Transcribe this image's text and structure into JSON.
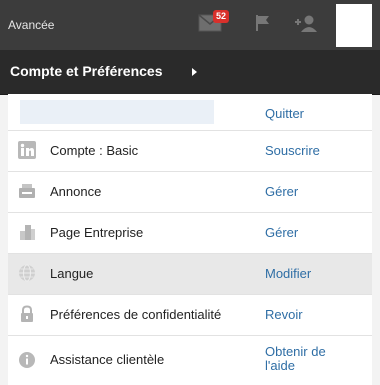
{
  "topbar": {
    "advanced_label": "Avancée",
    "messages_count": "52",
    "icons": [
      "envelope-icon",
      "flag-icon",
      "add-connection-icon"
    ]
  },
  "header": {
    "title": "Compte et Préférences"
  },
  "menu": {
    "quit_label": "Quitter",
    "items": [
      {
        "icon": "linkedin-icon",
        "label": "Compte : Basic",
        "action": "Souscrire"
      },
      {
        "icon": "ad-icon",
        "label": "Annonce",
        "action": "Gérer"
      },
      {
        "icon": "building-icon",
        "label": "Page Entreprise",
        "action": "Gérer"
      },
      {
        "icon": "globe-icon",
        "label": "Langue",
        "action": "Modifier"
      },
      {
        "icon": "lock-icon",
        "label": "Préférences de confidentialité",
        "action": "Revoir"
      },
      {
        "icon": "info-icon",
        "label": "Assistance clientèle",
        "action": "Obtenir de l'aide"
      }
    ]
  },
  "colors": {
    "topbar_bg": "#3c3c3c",
    "header_bg": "#2a2a2a",
    "link": "#2f6ea5",
    "badge": "#d8302b",
    "highlight_row": "#e8e8e8"
  }
}
